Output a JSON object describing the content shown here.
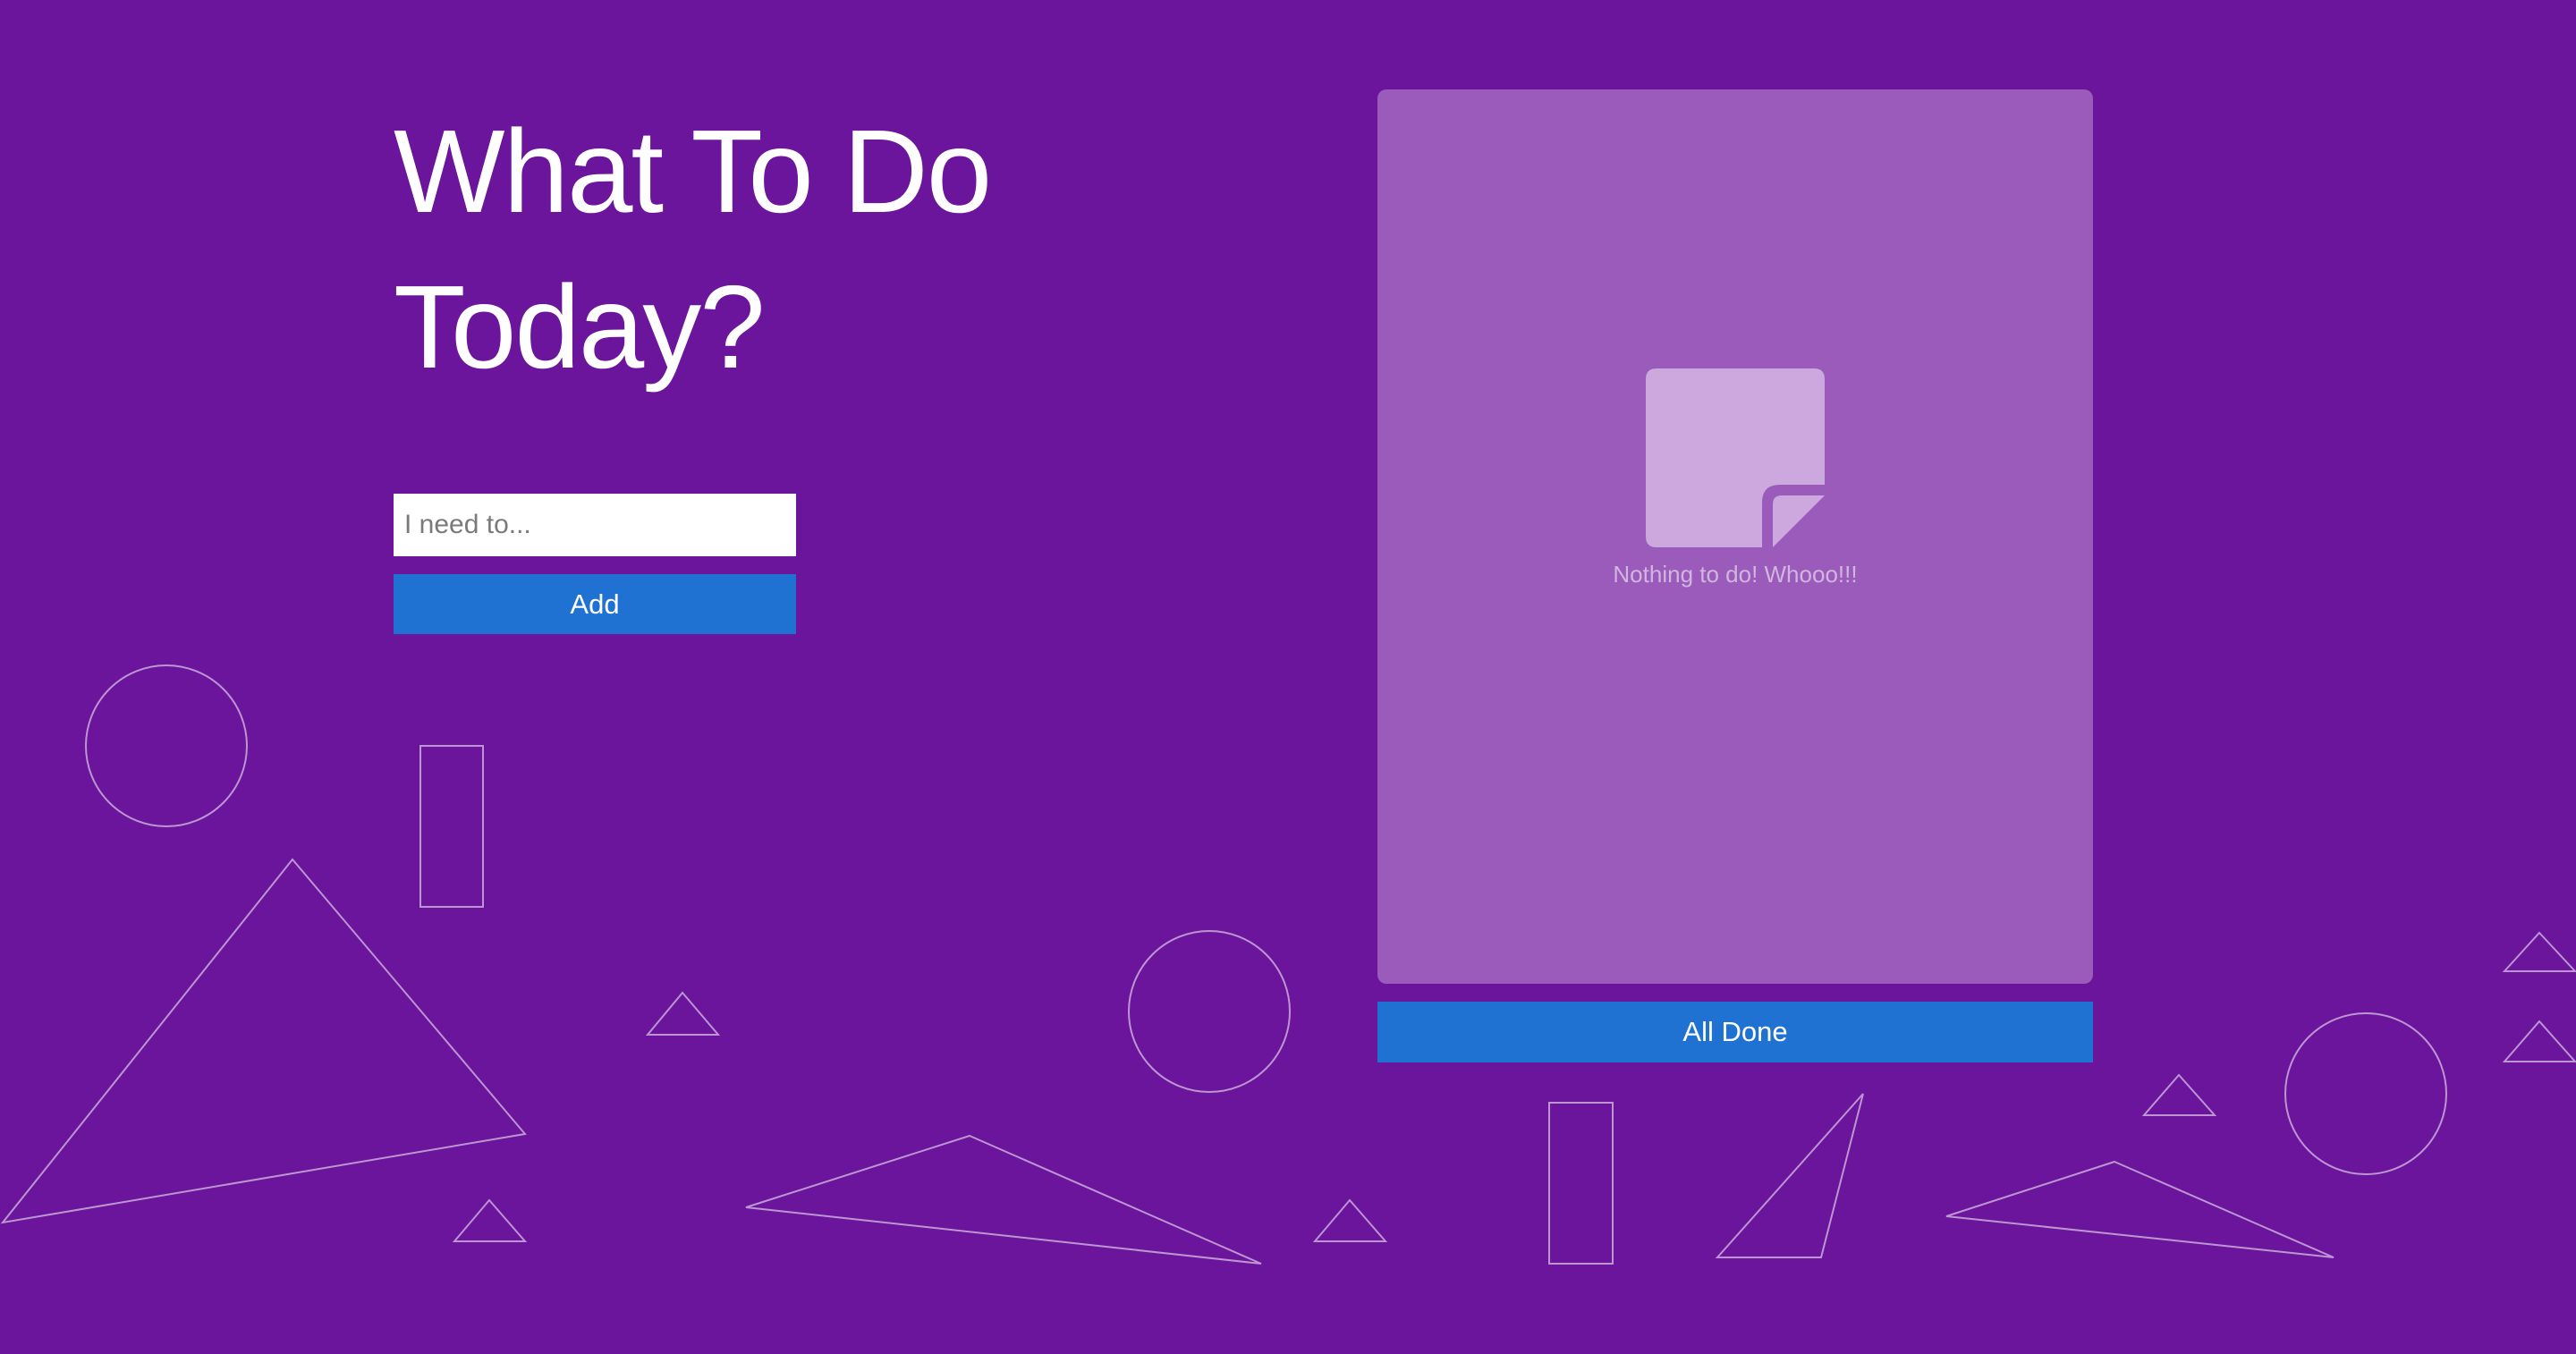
{
  "heading": {
    "line1": "What To Do",
    "line2": "Today?"
  },
  "form": {
    "input_placeholder": "I need to...",
    "input_value": "",
    "add_label": "Add"
  },
  "todo_list": {
    "items": [],
    "empty_icon": "sticky-note-icon",
    "empty_message": "Nothing to do! Whooo!!!",
    "all_done_label": "All Done"
  },
  "colors": {
    "background": "#6b149c",
    "panel": "#9a5bba",
    "button": "#2072d2",
    "icon": "#cca8de"
  }
}
